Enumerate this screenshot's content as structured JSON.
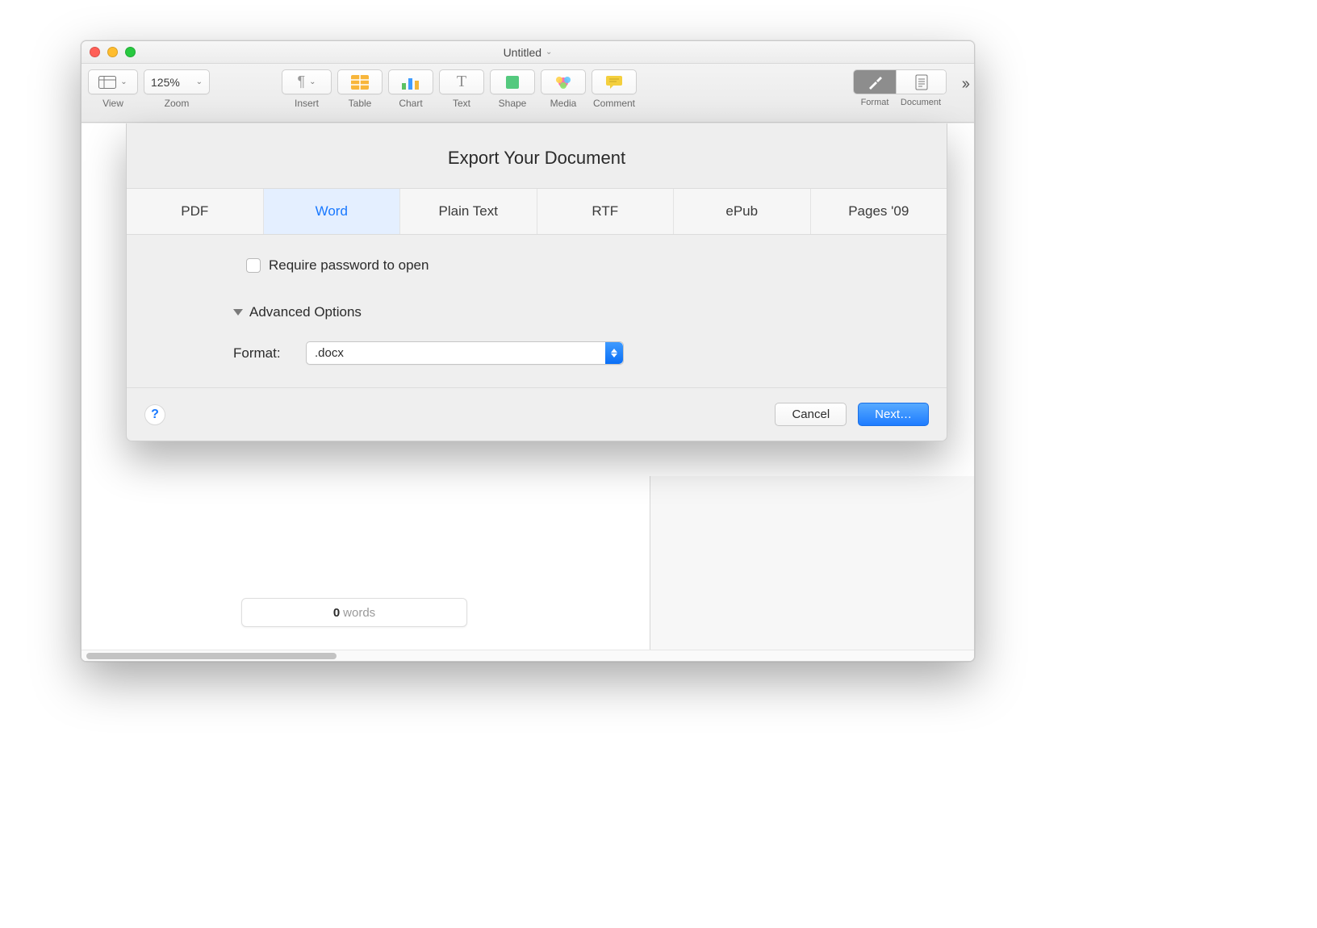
{
  "window": {
    "title": "Untitled"
  },
  "toolbar": {
    "view_label": "View",
    "zoom_value": "125%",
    "zoom_label": "Zoom",
    "insert_label": "Insert",
    "table_label": "Table",
    "chart_label": "Chart",
    "text_label": "Text",
    "shape_label": "Shape",
    "media_label": "Media",
    "comment_label": "Comment",
    "format_label": "Format",
    "document_label": "Document"
  },
  "wordcount": {
    "count": "0",
    "unit": "words"
  },
  "sheet": {
    "title": "Export Your Document",
    "tabs": {
      "pdf": "PDF",
      "word": "Word",
      "plain_text": "Plain Text",
      "rtf": "RTF",
      "epub": "ePub",
      "pages09": "Pages '09"
    },
    "active_tab": "word",
    "require_password_label": "Require password to open",
    "advanced_options_label": "Advanced Options",
    "format_label": "Format:",
    "format_value": ".docx",
    "cancel_label": "Cancel",
    "next_label": "Next…",
    "help_glyph": "?"
  }
}
